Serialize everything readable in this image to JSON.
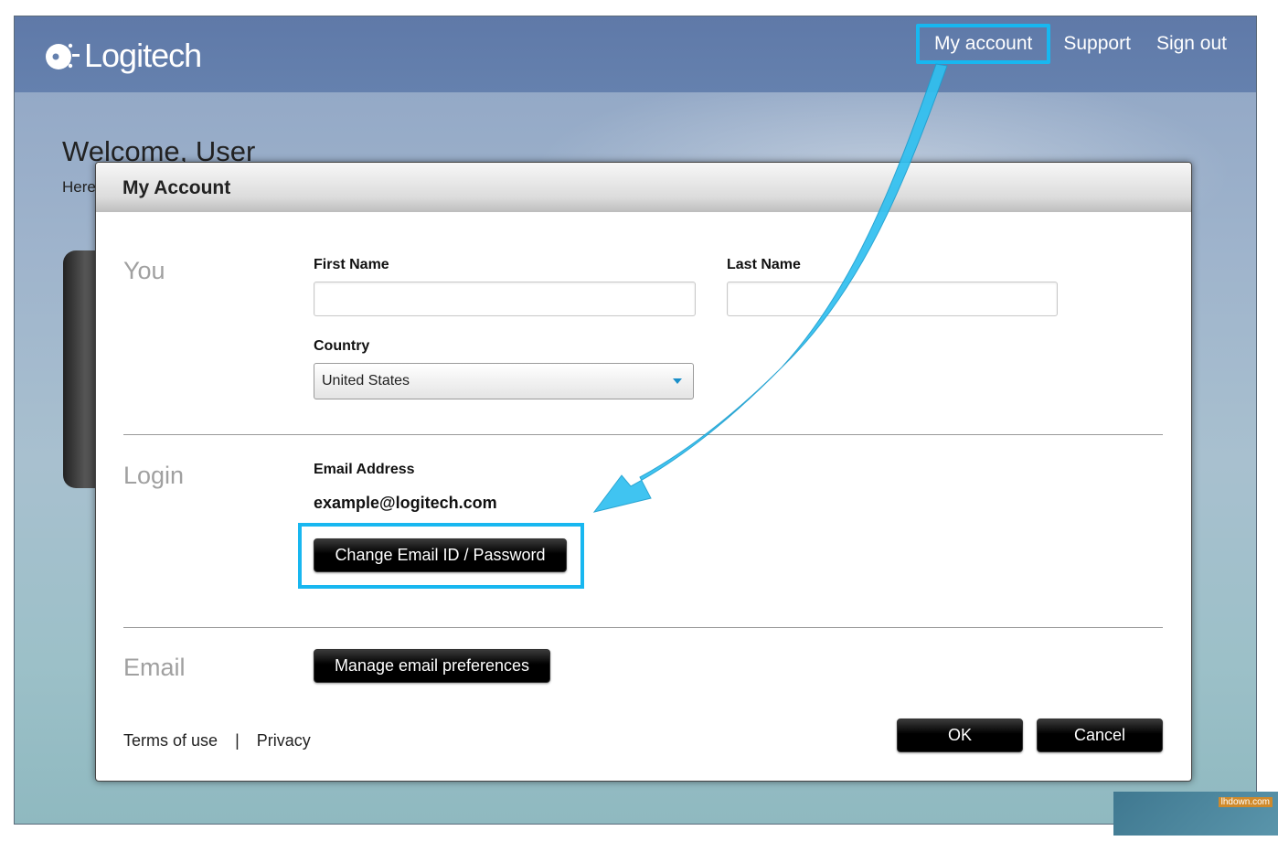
{
  "header": {
    "logo_text": "Logitech",
    "nav": {
      "my_account": "My account",
      "support": "Support",
      "sign_out": "Sign out"
    }
  },
  "page": {
    "welcome": "Welcome, User",
    "subtext": "Here"
  },
  "dialog": {
    "title": "My Account",
    "you": {
      "section_label": "You",
      "first_name_label": "First Name",
      "first_name_value": "",
      "last_name_label": "Last Name",
      "last_name_value": "",
      "country_label": "Country",
      "country_value": "United States"
    },
    "login": {
      "section_label": "Login",
      "email_label": "Email Address",
      "email_value": "example@logitech.com",
      "change_button": "Change Email ID / Password"
    },
    "email": {
      "section_label": "Email",
      "manage_button": "Manage email preferences"
    },
    "footer": {
      "terms": "Terms of use",
      "separator": "|",
      "privacy": "Privacy",
      "ok": "OK",
      "cancel": "Cancel"
    }
  },
  "annotation": {
    "highlight_color": "#18b7f0",
    "arrow_color": "#30c0f0"
  },
  "watermark": {
    "text": "lhdown.com"
  }
}
